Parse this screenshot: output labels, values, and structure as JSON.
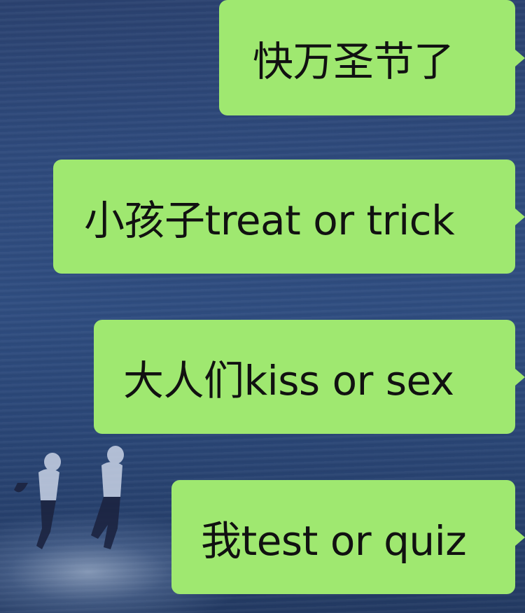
{
  "chat": {
    "messages": [
      {
        "text": "快万圣节了"
      },
      {
        "text": "小孩子treat or trick"
      },
      {
        "text": "大人们kiss or sex"
      },
      {
        "text": "我test or quiz"
      }
    ]
  },
  "colors": {
    "bubble": "#9fe870",
    "background": "#2e4a7c",
    "text": "#111111"
  }
}
